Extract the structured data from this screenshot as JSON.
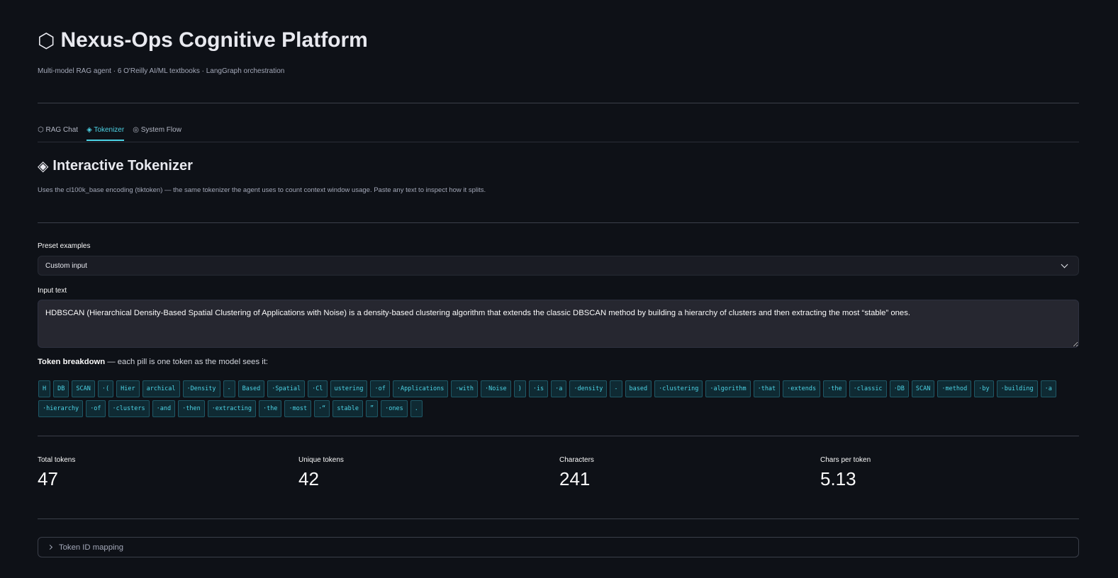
{
  "header": {
    "icon": "⬡",
    "title": "Nexus-Ops Cognitive Platform",
    "subtitle": "Multi-model RAG agent · 6 O'Reilly AI/ML textbooks · LangGraph orchestration"
  },
  "tabs": [
    {
      "label": "⬡ RAG Chat",
      "active": false
    },
    {
      "label": "◈ Tokenizer",
      "active": true
    },
    {
      "label": "◎ System Flow",
      "active": false
    }
  ],
  "section": {
    "icon": "◈",
    "title": "Interactive Tokenizer",
    "description": "Uses the cl100k_base encoding (tiktoken) — the same tokenizer the agent uses to count context window usage. Paste any text to inspect how it splits."
  },
  "preset": {
    "label": "Preset examples",
    "value": "Custom input"
  },
  "input": {
    "label": "Input text",
    "value": "HDBSCAN (Hierarchical Density-Based Spatial Clustering of Applications with Noise) is a density-based clustering algorithm that extends the classic DBSCAN method by building a hierarchy of clusters and then extracting the most “stable” ones."
  },
  "token_breakdown": {
    "heading_bold": "Token breakdown",
    "heading_rest": " — each pill is one token as the model sees it:",
    "tokens": [
      "H",
      "DB",
      "SCAN",
      "·(",
      "Hier",
      "archical",
      "·Density",
      "-",
      "Based",
      "·Spatial",
      "·Cl",
      "ustering",
      "·of",
      "·Applications",
      "·with",
      "·Noise",
      ")",
      "·is",
      "·a",
      "·density",
      "-",
      "based",
      "·clustering",
      "·algorithm",
      "·that",
      "·extends",
      "·the",
      "·classic",
      "·DB",
      "SCAN",
      "·method",
      "·by",
      "·building",
      "·a",
      "·hierarchy",
      "·of",
      "·clusters",
      "·and",
      "·then",
      "·extracting",
      "·the",
      "·most",
      "·“",
      "stable",
      "”",
      "·ones",
      "."
    ]
  },
  "metrics": [
    {
      "label": "Total tokens",
      "value": "47"
    },
    {
      "label": "Unique tokens",
      "value": "42"
    },
    {
      "label": "Characters",
      "value": "241"
    },
    {
      "label": "Chars per token",
      "value": "5.13"
    }
  ],
  "expander": {
    "label": "Token ID mapping"
  },
  "colors": {
    "background": "#0e1117",
    "accent": "#4dd4e6",
    "pill_bg": "#0f2a33"
  }
}
